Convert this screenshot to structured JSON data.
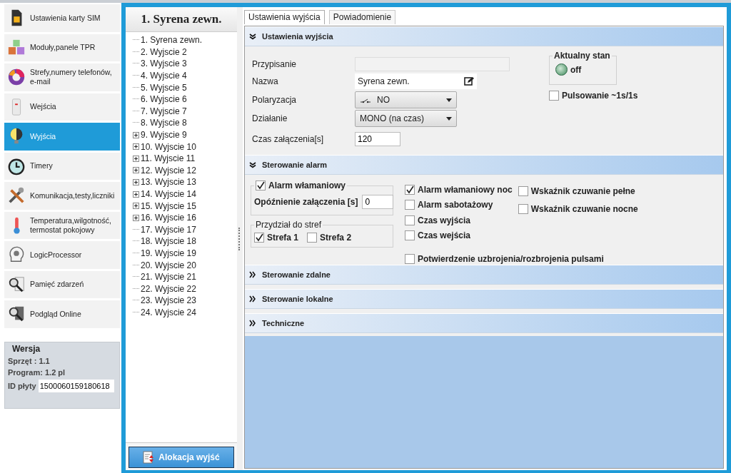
{
  "sidebar": {
    "items": [
      {
        "label": "Ustawienia karty SIM",
        "kind": "sim",
        "selected": false
      },
      {
        "label": "Moduły,panele TPR",
        "kind": "cubes",
        "selected": false
      },
      {
        "label": "Strefy,numery telefonów, e-mail",
        "kind": "donut",
        "selected": false
      },
      {
        "label": "Wejścia",
        "kind": "sensor",
        "selected": false
      },
      {
        "label": "Wyjścia",
        "kind": "bulb",
        "selected": true
      },
      {
        "label": "Timery",
        "kind": "clock",
        "selected": false
      },
      {
        "label": "Komunikacja,testy,liczniki",
        "kind": "tools",
        "selected": false
      },
      {
        "label": "Temperatura,wilgotność, termostat pokojowy",
        "kind": "thermo",
        "selected": false
      },
      {
        "label": "LogicProcessor",
        "kind": "head",
        "selected": false
      },
      {
        "label": "Pamięć zdarzeń",
        "kind": "log",
        "selected": false
      },
      {
        "label": "Podgląd Online",
        "kind": "chip",
        "selected": false
      }
    ]
  },
  "version": {
    "title": "Wersja",
    "hardware": "Sprzęt : 1.1",
    "program": "Program: 1.2 pl",
    "board_id_label": "ID płyty",
    "board_id": "1500060159180618"
  },
  "tree": {
    "title": "1. Syrena zewn.",
    "items": [
      {
        "label": "1. Syrena zewn.",
        "expandable": false
      },
      {
        "label": "2. Wyjscie 2",
        "expandable": false
      },
      {
        "label": "3. Wyjscie 3",
        "expandable": false
      },
      {
        "label": "4. Wyjscie 4",
        "expandable": false
      },
      {
        "label": "5. Wyjscie 5",
        "expandable": false
      },
      {
        "label": "6. Wyjscie 6",
        "expandable": false
      },
      {
        "label": "7. Wyjscie 7",
        "expandable": false
      },
      {
        "label": "8. Wyjscie 8",
        "expandable": false
      },
      {
        "label": "9. Wyjscie 9",
        "expandable": true
      },
      {
        "label": "10. Wyjscie 10",
        "expandable": true
      },
      {
        "label": "11. Wyjscie 11",
        "expandable": true
      },
      {
        "label": "12. Wyjscie 12",
        "expandable": true
      },
      {
        "label": "13. Wyjscie 13",
        "expandable": true
      },
      {
        "label": "14. Wyjscie 14",
        "expandable": true
      },
      {
        "label": "15. Wyjscie 15",
        "expandable": true
      },
      {
        "label": "16. Wyjscie 16",
        "expandable": true
      },
      {
        "label": "17. Wyjscie 17",
        "expandable": false
      },
      {
        "label": "18. Wyjscie 18",
        "expandable": false
      },
      {
        "label": "19. Wyjscie 19",
        "expandable": false
      },
      {
        "label": "20. Wyjscie 20",
        "expandable": false
      },
      {
        "label": "21. Wyjscie 21",
        "expandable": false
      },
      {
        "label": "22. Wyjscie 22",
        "expandable": false
      },
      {
        "label": "23. Wyjscie 23",
        "expandable": false
      },
      {
        "label": "24. Wyjscie 24",
        "expandable": false
      }
    ],
    "button": "Alokacja wyjść"
  },
  "tabs": [
    {
      "label": "Ustawienia wyjścia",
      "selected": true
    },
    {
      "label": "Powiadomienie",
      "selected": false
    }
  ],
  "sections": [
    {
      "title": "Ustawienia wyjścia",
      "expanded": true
    },
    {
      "title": "Sterowanie alarm",
      "expanded": true
    },
    {
      "title": "Sterowanie zdalne",
      "expanded": false
    },
    {
      "title": "Sterowanie lokalne",
      "expanded": false
    },
    {
      "title": "Techniczne",
      "expanded": false
    }
  ],
  "output_settings": {
    "assignment_label": "Przypisanie",
    "name_label": "Nazwa",
    "name_value": "Syrena zewn.",
    "polarization_label": "Polaryzacja",
    "polarization_value": "NO",
    "action_label": "Działanie",
    "action_value": "MONO (na czas)",
    "on_time_label": "Czas załączenia[s]",
    "on_time_value": "120",
    "state_title": "Aktualny stan",
    "state_on": false,
    "state_text": "off",
    "pulsing": {
      "label": "Pulsowanie ~1s/1s",
      "checked": false
    }
  },
  "alarm_control": {
    "burglary": {
      "label": "Alarm włamaniowy",
      "checked": true
    },
    "delay_label": "Opóźnienie  załączenia [s]",
    "delay_value": "0",
    "zones_title": "Przydział do stref",
    "zones": [
      {
        "label": "Strefa 1",
        "checked": true
      },
      {
        "label": "Strefa 2",
        "checked": false
      }
    ],
    "middle": [
      {
        "label": "Alarm włamaniowy noc",
        "checked": true
      },
      {
        "label": "Alarm sabotażowy",
        "checked": false
      },
      {
        "label": "Czas wyjścia",
        "checked": false
      },
      {
        "label": "Czas wejścia",
        "checked": false
      }
    ],
    "right": [
      {
        "label": "Wskaźnik czuwanie pełne",
        "checked": false
      },
      {
        "label": "Wskaźnik czuwanie nocne",
        "checked": false
      }
    ],
    "confirm": {
      "label": "Potwierdzenie uzbrojenia/rozbrojenia pulsami",
      "checked": false
    }
  }
}
